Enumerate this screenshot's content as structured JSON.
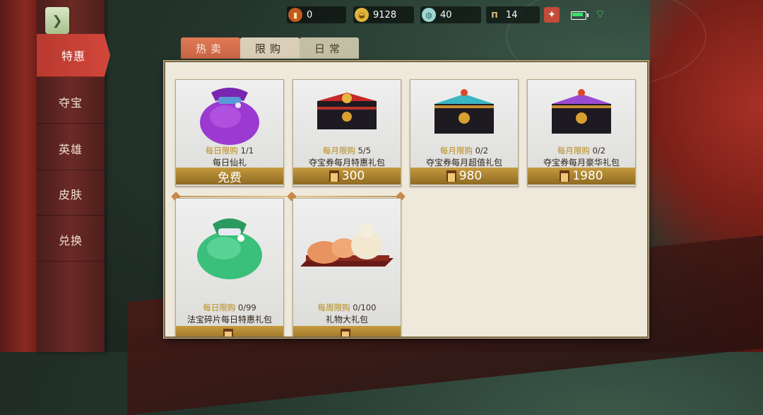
{
  "topbar": {
    "currencies": [
      {
        "icon": "scroll-token-icon",
        "value": "0"
      },
      {
        "icon": "gold-ingot-icon",
        "value": "9128"
      },
      {
        "icon": "jade-orb-icon",
        "value": "40"
      },
      {
        "icon": "treasure-ticket-icon",
        "value": "14"
      }
    ],
    "add_icon": "plus-sparkle-icon"
  },
  "sidebar": {
    "tabs": [
      {
        "label": "特惠",
        "active": true
      },
      {
        "label": "夺宝",
        "active": false
      },
      {
        "label": "英雄",
        "active": false
      },
      {
        "label": "皮肤",
        "active": false
      },
      {
        "label": "兑换",
        "active": false
      }
    ]
  },
  "shop_tabs": [
    {
      "label": "热卖"
    },
    {
      "label": "限购"
    },
    {
      "label": "日常"
    }
  ],
  "items": [
    {
      "limit_type": "每日限购",
      "limit_count": "1/1",
      "name": "每日仙礼",
      "price": "免费",
      "price_icon": false,
      "art": "purple-pouch"
    },
    {
      "limit_type": "每月限购",
      "limit_count": "5/5",
      "name": "夺宝券每月特惠礼包",
      "price": "300",
      "price_icon": true,
      "art": "red-chest"
    },
    {
      "limit_type": "每月限购",
      "limit_count": "0/2",
      "name": "夺宝券每月超值礼包",
      "price": "980",
      "price_icon": true,
      "art": "teal-chest"
    },
    {
      "limit_type": "每月限购",
      "limit_count": "0/2",
      "name": "夺宝券每月豪华礼包",
      "price": "1980",
      "price_icon": true,
      "art": "purple-chest"
    },
    {
      "limit_type": "每日限购",
      "limit_count": "0/99",
      "name": "法宝碎片每日特惠礼包",
      "price": "",
      "price_icon": false,
      "art": "green-pouch"
    },
    {
      "limit_type": "每周限购",
      "limit_count": "0/100",
      "name": "礼物大礼包",
      "price": "",
      "price_icon": false,
      "art": "bun-tray"
    }
  ],
  "colors": {
    "accent": "#d3463a",
    "gold": "#c59a3e",
    "limit_tag": "#b88a16"
  }
}
